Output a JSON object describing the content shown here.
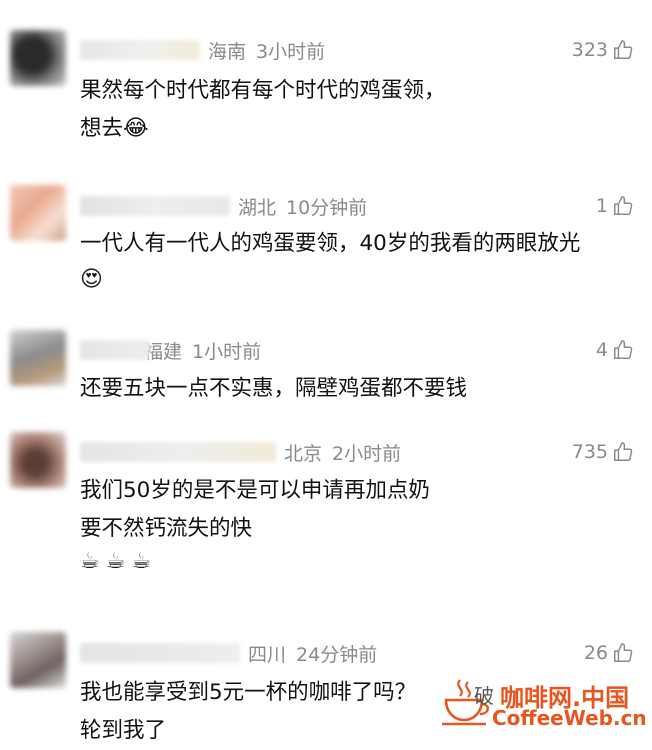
{
  "comments": [
    {
      "location": "海南",
      "time": "3小时前",
      "likes": "323",
      "lines": [
        "果然每个时代都有每个时代的鸡蛋领，",
        "想去"
      ],
      "emojis": [
        "😂"
      ]
    },
    {
      "location": "湖北",
      "time": "10分钟前",
      "likes": "1",
      "lines": [
        "一代人有一代人的鸡蛋要领，40岁的我看的两眼放光"
      ],
      "emojis": [
        "😍"
      ]
    },
    {
      "location": "福建",
      "location_visible": "福建",
      "time": "1小时前",
      "likes": "4",
      "lines": [
        "还要五块一点不实惠，隔壁鸡蛋都不要钱"
      ],
      "emojis": []
    },
    {
      "location": "北京",
      "time": "2小时前",
      "likes": "735",
      "lines": [
        "我们50岁的是不是可以申请再加点奶",
        "要不然钙流失的快"
      ],
      "emojis": [
        "☕",
        "☕",
        "☕"
      ]
    },
    {
      "location": "四川",
      "time": "24分钟前",
      "likes": "26",
      "lines": [
        "我也能享受到5元一杯的咖啡了吗？",
        "轮到我了"
      ],
      "emojis": []
    }
  ],
  "watermark": {
    "title": "咖啡网.中国",
    "url": "CoffeeWeb.cn",
    "faint_text": "破"
  },
  "colors": {
    "meta": "#8a8a8a",
    "watermark": "#e8551e"
  }
}
